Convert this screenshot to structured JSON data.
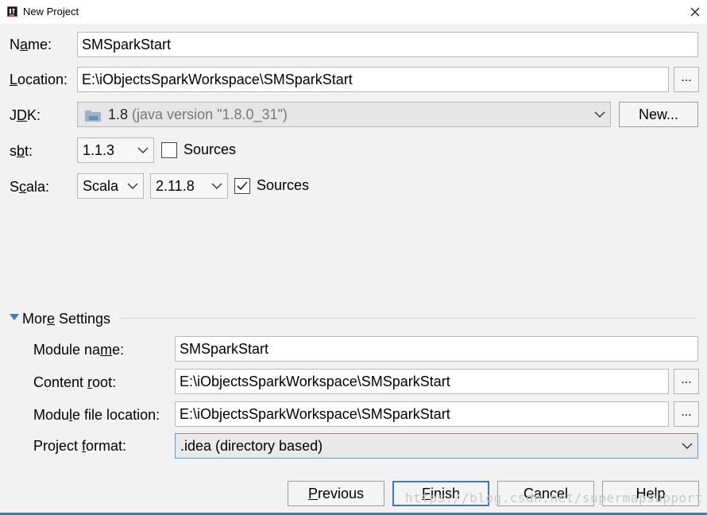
{
  "window": {
    "title": "New Project"
  },
  "form": {
    "name_label": "Name:",
    "name_value": "SMSparkStart",
    "location_label": "Location:",
    "location_value": "E:\\iObjectsSparkWorkspace\\SMSparkStart",
    "browse_label": "...",
    "jdk_label": "JDK:",
    "jdk_version": "1.8",
    "jdk_detail": "(java version \"1.8.0_31\")",
    "jdk_new_label": "New...",
    "sbt_label": "sbt:",
    "sbt_version": "1.1.3",
    "sbt_sources_label": "Sources",
    "sbt_sources_checked": false,
    "scala_label": "Scala:",
    "scala_dist": "Scala",
    "scala_version": "2.11.8",
    "scala_sources_label": "Sources",
    "scala_sources_checked": true
  },
  "more_settings": {
    "header": "More Settings",
    "module_name_label": "Module name:",
    "module_name_value": "SMSparkStart",
    "content_root_label": "Content root:",
    "content_root_value": "E:\\iObjectsSparkWorkspace\\SMSparkStart",
    "module_file_label": "Module file location:",
    "module_file_value": "E:\\iObjectsSparkWorkspace\\SMSparkStart",
    "project_format_label": "Project format:",
    "project_format_value": ".idea (directory based)"
  },
  "buttons": {
    "previous": "Previous",
    "finish": "Finish",
    "cancel": "Cancel",
    "help": "Help"
  },
  "watermark": "https://blog.csdn.net/supermapsupport",
  "colors": {
    "accent": "#3a7cc0",
    "background": "#f2f2f2"
  }
}
